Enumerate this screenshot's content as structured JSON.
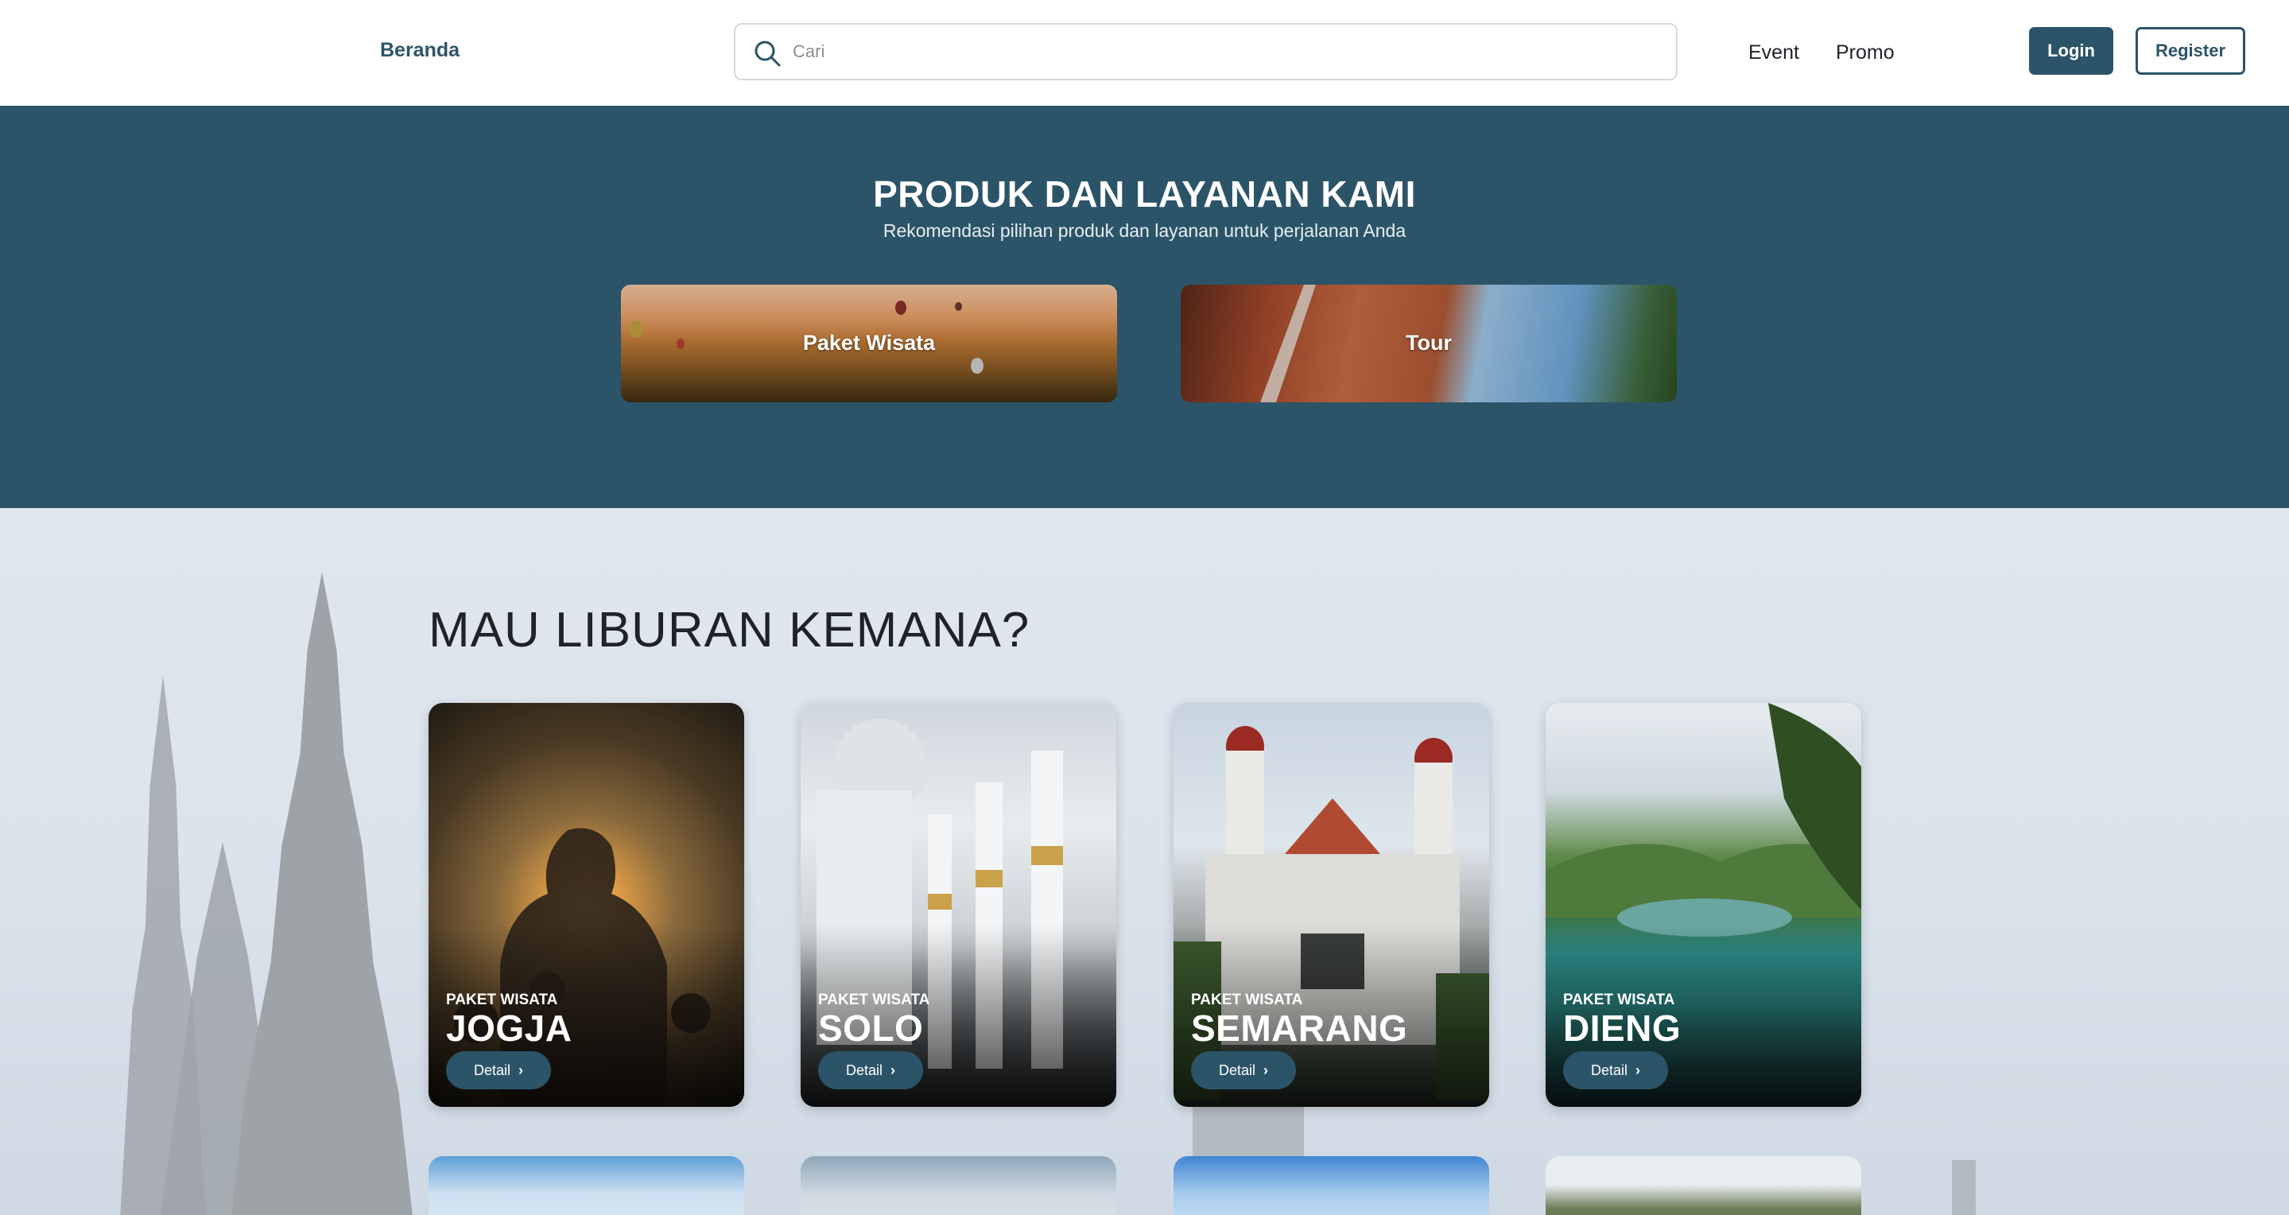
{
  "header": {
    "brand": "Beranda",
    "search": {
      "placeholder": "Cari",
      "value": ""
    },
    "nav": {
      "event": "Event",
      "promo": "Promo"
    },
    "login_label": "Login",
    "register_label": "Register"
  },
  "products": {
    "title": "PRODUK DAN LAYANAN KAMI",
    "subtitle": "Rekomendasi pilihan produk dan layanan untuk perjalanan Anda",
    "items": [
      {
        "label": "Paket Wisata"
      },
      {
        "label": "Tour"
      }
    ]
  },
  "destinations": {
    "title": "MAU LIBURAN KEMANA?",
    "cards": [
      {
        "kicker": "PAKET WISATA",
        "name": "JOGJA",
        "button": "Detail"
      },
      {
        "kicker": "PAKET WISATA",
        "name": "SOLO",
        "button": "Detail"
      },
      {
        "kicker": "PAKET WISATA",
        "name": "SEMARANG",
        "button": "Detail"
      },
      {
        "kicker": "PAKET WISATA",
        "name": "DIENG",
        "button": "Detail"
      }
    ]
  },
  "colors": {
    "primary": "#2c5468",
    "section_bg": "#2c5468",
    "text_dark": "#1f2328"
  }
}
